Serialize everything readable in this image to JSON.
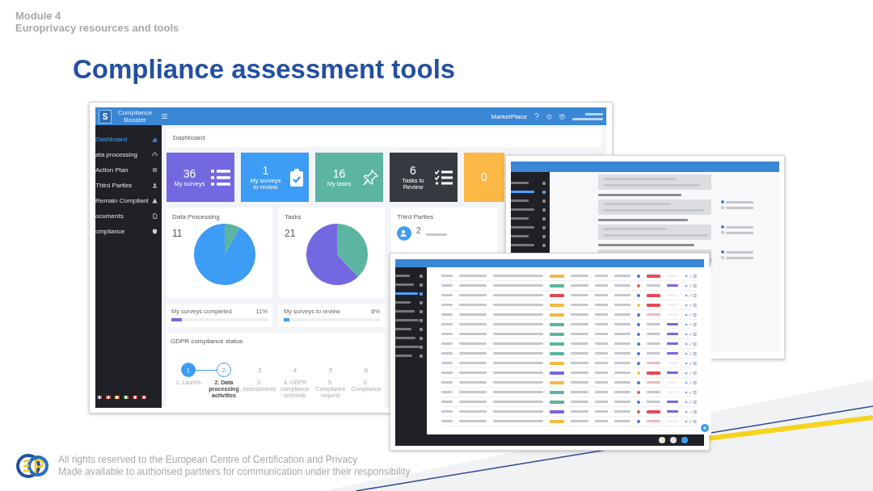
{
  "slide": {
    "module": "Module 4",
    "subtitle": "Europrivacy resources and tools",
    "title": "Compliance assessment tools"
  },
  "app": {
    "brand_letter": "S",
    "brand": "Compliance Booster",
    "marketplace": "MarketPlace",
    "page_title": "Dashboard",
    "sidebar": [
      {
        "label": "Dashboard",
        "selected": true
      },
      {
        "label": "ata processing",
        "selected": false
      },
      {
        "label": "Action Plan",
        "selected": false
      },
      {
        "label": "Third Parties",
        "selected": false
      },
      {
        "label": "Remain Compliant",
        "selected": false
      },
      {
        "label": "ocuments",
        "selected": false
      },
      {
        "label": "ompliance",
        "selected": false
      }
    ],
    "tiles": [
      {
        "value": "36",
        "label": "My surveys",
        "color": "#7468e0"
      },
      {
        "value": "1",
        "label": "My surveys to review",
        "color": "#3d9cf5"
      },
      {
        "value": "16",
        "label": "My tasks",
        "color": "#5bb5a2"
      },
      {
        "value": "6",
        "label": "Tasks to Review",
        "color": "#353a40"
      },
      {
        "value": "0",
        "color": "#fbb845"
      }
    ],
    "cards": [
      {
        "title": "Data Processing",
        "count": "11"
      },
      {
        "title": "Tasks",
        "count": "21"
      }
    ],
    "third_parties": {
      "title": "Third Parties",
      "entries": [
        {
          "count": "2",
          "color": "#3d9cf5"
        }
      ]
    },
    "progress": [
      {
        "label": "My surveys completed",
        "reading": "11%",
        "level": 0.11,
        "color": "#7468e0"
      },
      {
        "label": "My surveys to review",
        "reading": "6%",
        "level": 0.06,
        "color": "#3d9cf5"
      }
    ],
    "status": {
      "title": "GDPR compliance status",
      "steps": [
        {
          "number": "1",
          "label": "1. Launch",
          "done": true,
          "selected": false
        },
        {
          "number": "2",
          "label": "2. Data processing activities",
          "done": false,
          "selected": true
        },
        {
          "number": "3",
          "label": "3. Assessments",
          "done": false,
          "selected": false
        },
        {
          "number": "4",
          "label": "4. GDPR compliance schedule",
          "done": false,
          "selected": false
        },
        {
          "number": "5",
          "label": "5. Compliance request",
          "done": false,
          "selected": false
        },
        {
          "number": "6",
          "label": "6. Compliance",
          "done": false,
          "selected": false
        }
      ]
    }
  },
  "assessment_sections": [
    {
      "options": [
        {
          "checked": true
        },
        {
          "checked": false
        }
      ]
    },
    {
      "options": [
        {
          "checked": true
        },
        {
          "checked": false
        }
      ]
    },
    {
      "options": [
        {
          "checked": true
        },
        {
          "checked": false
        }
      ]
    }
  ],
  "task_rows": [
    {
      "status": {
        "color": "#f5b942"
      },
      "owner_dot": {
        "color": "#4a6fd6"
      },
      "result": {
        "kind": "badge",
        "color": "#e64b55"
      },
      "tag": false
    },
    {
      "status": {
        "color": "#5bb5a2"
      },
      "owner_dot": {
        "color": "#e0574f"
      },
      "result": {
        "kind": "date"
      },
      "tag": true
    },
    {
      "status": {
        "color": "#e64b55"
      },
      "owner_dot": {
        "color": "#4a6fd6"
      },
      "result": {
        "kind": "badge",
        "color": "#e64b55"
      },
      "tag": false
    },
    {
      "status": {
        "color": "#f5b942"
      },
      "owner_dot": {
        "color": "#f5c542"
      },
      "result": {
        "kind": "badge",
        "color": "#e64b55"
      },
      "tag": false
    },
    {
      "status": {
        "color": "#f5b942"
      },
      "owner_dot": {
        "color": "#4a6fd6"
      },
      "result": {
        "kind": "note"
      },
      "tag": false
    },
    {
      "status": {
        "color": "#5bb5a2"
      },
      "owner_dot": {
        "color": "#4a6fd6"
      },
      "result": {
        "kind": "date"
      },
      "tag": true
    },
    {
      "status": {
        "color": "#5bb5a2"
      },
      "owner_dot": {
        "color": "#4a6fd6"
      },
      "result": {
        "kind": "date"
      },
      "tag": true
    },
    {
      "status": {
        "color": "#5bb5a2"
      },
      "owner_dot": {
        "color": "#4a6fd6"
      },
      "result": {
        "kind": "date"
      },
      "tag": true
    },
    {
      "status": {
        "color": "#5bb5a2"
      },
      "owner_dot": {
        "color": "#4a6fd6"
      },
      "result": {
        "kind": "date"
      },
      "tag": true
    },
    {
      "status": {
        "color": "#f5b942"
      },
      "owner_dot": {
        "color": "#4a6fd6"
      },
      "result": {
        "kind": "note"
      },
      "tag": false
    },
    {
      "status": {
        "color": "#7468e0"
      },
      "owner_dot": {
        "color": "#f5c542"
      },
      "result": {
        "kind": "badge",
        "color": "#e64b55"
      },
      "tag": true
    },
    {
      "status": {
        "color": "#f5b942"
      },
      "owner_dot": {
        "color": "#4a6fd6"
      },
      "result": {
        "kind": "note"
      },
      "tag": false
    },
    {
      "status": {
        "color": "#5bb5a2"
      },
      "owner_dot": {
        "color": "#e0574f"
      },
      "result": {
        "kind": "date"
      },
      "tag": false
    },
    {
      "status": {
        "color": "#5bb5a2"
      },
      "owner_dot": {
        "color": "#4a6fd6"
      },
      "result": {
        "kind": "date"
      },
      "tag": true
    },
    {
      "status": {
        "color": "#7468e0"
      },
      "owner_dot": {
        "color": "#e0574f"
      },
      "result": {
        "kind": "badge",
        "color": "#e64b55"
      },
      "tag": true
    },
    {
      "status": {
        "color": "#f5b942"
      },
      "owner_dot": {
        "color": "#4a6fd6"
      },
      "result": {
        "kind": "note"
      },
      "tag": false
    }
  ],
  "footer": {
    "line1": "All rights reserved to the European Centre of Certification and Privacy",
    "line2": "Made available to authorised partners for communication under their responsibility"
  }
}
